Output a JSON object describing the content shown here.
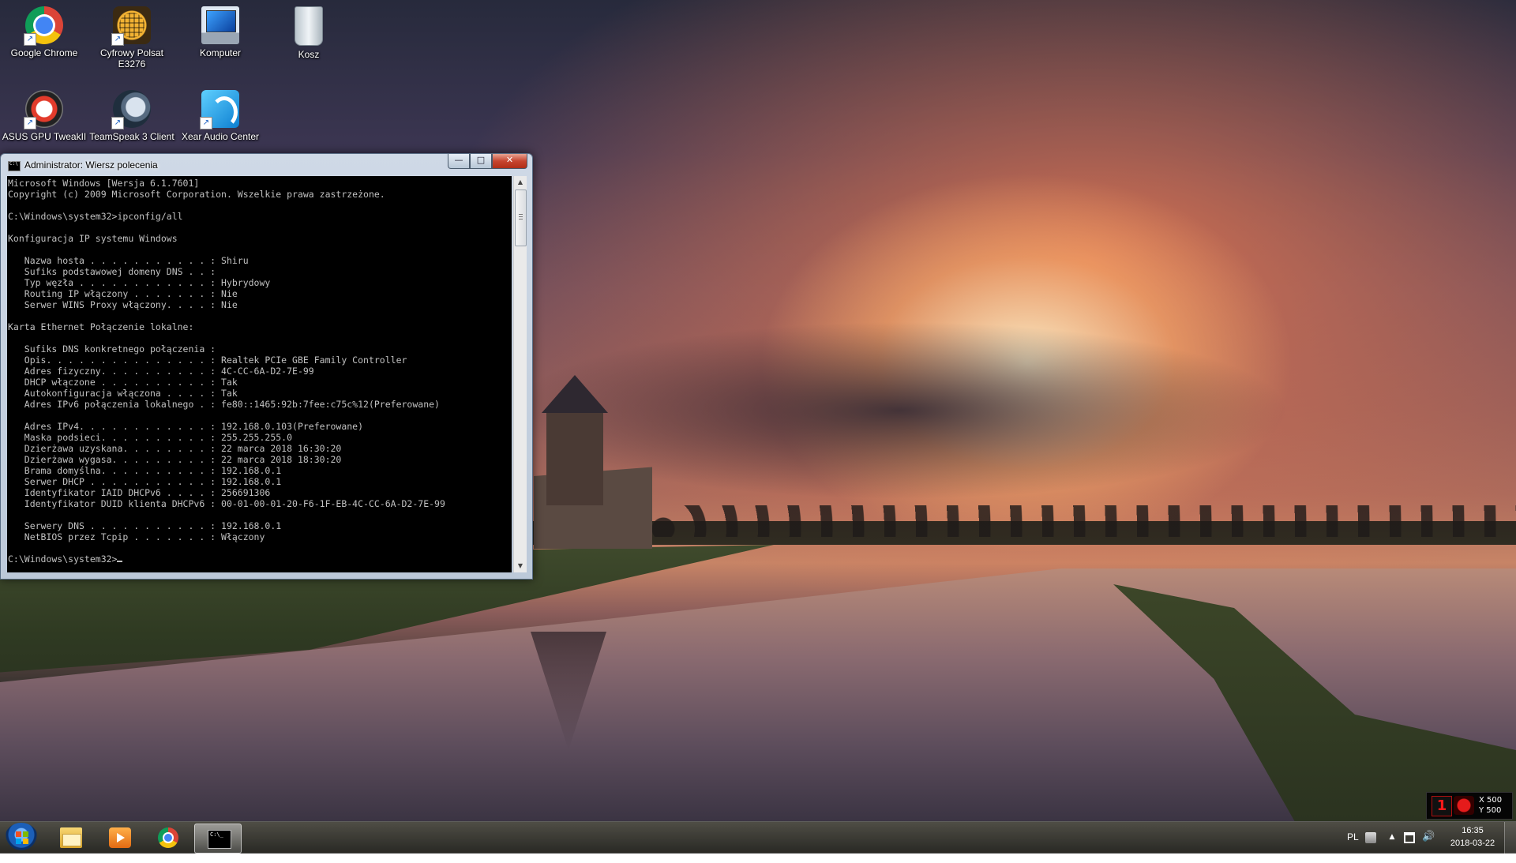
{
  "desktop": {
    "icons": [
      {
        "label": "Google Chrome"
      },
      {
        "label": "Cyfrowy Polsat E3276"
      },
      {
        "label": "Komputer"
      },
      {
        "label": "Kosz"
      },
      {
        "label": "ASUS GPU TweakII"
      },
      {
        "label": "TeamSpeak 3 Client"
      },
      {
        "label": "Xear Audio Center"
      }
    ]
  },
  "cmd_window": {
    "title": "Administrator: Wiersz polecenia",
    "buttons": {
      "minimize": "—",
      "maximize": "□",
      "close": "✕"
    },
    "lines": [
      "Microsoft Windows [Wersja 6.1.7601]",
      "Copyright (c) 2009 Microsoft Corporation. Wszelkie prawa zastrzeżone.",
      "",
      "C:\\Windows\\system32>ipconfig/all",
      "",
      "Konfiguracja IP systemu Windows",
      "",
      "   Nazwa hosta . . . . . . . . . . . : Shiru",
      "   Sufiks podstawowej domeny DNS . . :",
      "   Typ węzła . . . . . . . . . . . . : Hybrydowy",
      "   Routing IP włączony . . . . . . . : Nie",
      "   Serwer WINS Proxy włączony. . . . : Nie",
      "",
      "Karta Ethernet Połączenie lokalne:",
      "",
      "   Sufiks DNS konkretnego połączenia :",
      "   Opis. . . . . . . . . . . . . . . : Realtek PCIe GBE Family Controller",
      "   Adres fizyczny. . . . . . . . . . : 4C-CC-6A-D2-7E-99",
      "   DHCP włączone . . . . . . . . . . : Tak",
      "   Autokonfiguracja włączona . . . . : Tak",
      "   Adres IPv6 połączenia lokalnego . : fe80::1465:92b:7fee:c75c%12(Preferowane)",
      "",
      "   Adres IPv4. . . . . . . . . . . . : 192.168.0.103(Preferowane)",
      "   Maska podsieci. . . . . . . . . . : 255.255.255.0",
      "   Dzierżawa uzyskana. . . . . . . . : 22 marca 2018 16:30:20",
      "   Dzierżawa wygasa. . . . . . . . . : 22 marca 2018 18:30:20",
      "   Brama domyślna. . . . . . . . . . : 192.168.0.1",
      "   Serwer DHCP . . . . . . . . . . . : 192.168.0.1",
      "   Identyfikator IAID DHCPv6 . . . . : 256691306",
      "   Identyfikator DUID klienta DHCPv6 : 00-01-00-01-20-F6-1F-EB-4C-CC-6A-D2-7E-99",
      "",
      "   Serwery DNS . . . . . . . . . . . : 192.168.0.1",
      "   NetBIOS przez Tcpip . . . . . . . : Włączony",
      ""
    ],
    "prompt": "C:\\Windows\\system32>"
  },
  "taskbar": {
    "items": [
      {
        "icon": "windows-explorer-icon"
      },
      {
        "icon": "media-player-icon"
      },
      {
        "icon": "chrome-icon"
      },
      {
        "icon": "command-prompt-icon",
        "active": true
      }
    ],
    "tray": {
      "language": "PL",
      "icons": [
        "printer-icon",
        "show-hidden-icons-arrow",
        "network-icon",
        "volume-icon"
      ]
    },
    "clock": {
      "time": "16:35",
      "date": "2018-03-22"
    }
  },
  "overlay": {
    "x_label": "X 500",
    "y_label": "Y 500",
    "accent": "#e51b1b"
  }
}
